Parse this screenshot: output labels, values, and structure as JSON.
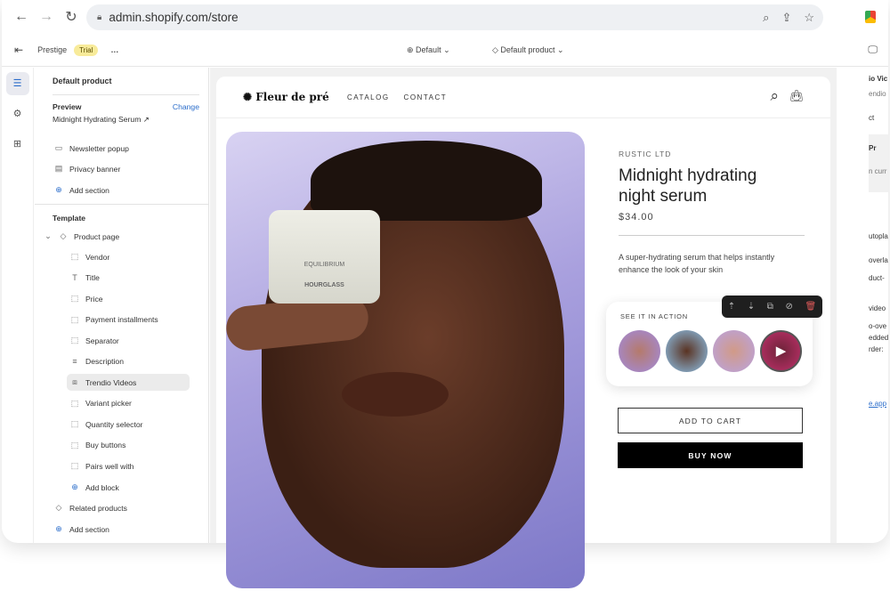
{
  "browser": {
    "url": "admin.shopify.com/store"
  },
  "toolbar": {
    "store": "Prestige",
    "badge": "Trial",
    "more": "…",
    "theme": "Default",
    "template": "Default product"
  },
  "sidebar": {
    "title": "Default product",
    "preview_label": "Preview",
    "change": "Change",
    "preview_value": "Midnight Hydrating Serum",
    "header_items": [
      {
        "icon": "popup-icon",
        "label": "Newsletter popup"
      },
      {
        "icon": "banner-icon",
        "label": "Privacy banner"
      }
    ],
    "add_section": "Add section",
    "template_label": "Template",
    "product_page": "Product page",
    "blocks": [
      {
        "icon": "block-icon",
        "label": "Vendor"
      },
      {
        "icon": "text-icon",
        "label": "Title"
      },
      {
        "icon": "block-icon",
        "label": "Price"
      },
      {
        "icon": "block-icon",
        "label": "Payment installments"
      },
      {
        "icon": "block-icon",
        "label": "Separator"
      },
      {
        "icon": "lines-icon",
        "label": "Description"
      },
      {
        "icon": "app-icon",
        "label": "Trendio Videos"
      },
      {
        "icon": "block-icon",
        "label": "Variant picker"
      },
      {
        "icon": "block-icon",
        "label": "Quantity selector"
      },
      {
        "icon": "block-icon",
        "label": "Buy buttons"
      },
      {
        "icon": "block-icon",
        "label": "Pairs well with"
      }
    ],
    "add_block": "Add block",
    "related": "Related products",
    "add_section2": "Add section"
  },
  "store": {
    "logo": "Fleur de pré",
    "nav": [
      "CATALOG",
      "CONTACT"
    ],
    "vendor": "RUSTIC LTD",
    "title": "Midnight hydrating night serum",
    "price": "$34.00",
    "description": "A super-hydrating serum that helps instantly enhance the look of your skin",
    "widget_title": "SEE IT IN ACTION",
    "add_to_cart": "ADD TO CART",
    "buy_now": "BUY NOW",
    "jar_brand": "EQUILIBRIUM",
    "jar_maker": "HOURGLASS"
  },
  "right_panel": {
    "lines": [
      "io Vic",
      "endio",
      "ct",
      "Pr",
      "n curr",
      "utopla",
      "overla",
      "duct-",
      "video",
      "o-ove",
      "edded",
      "rder:",
      "e.app"
    ]
  },
  "colors": {
    "accent": "#2c6ecb",
    "trial": "#f8eb9a"
  }
}
